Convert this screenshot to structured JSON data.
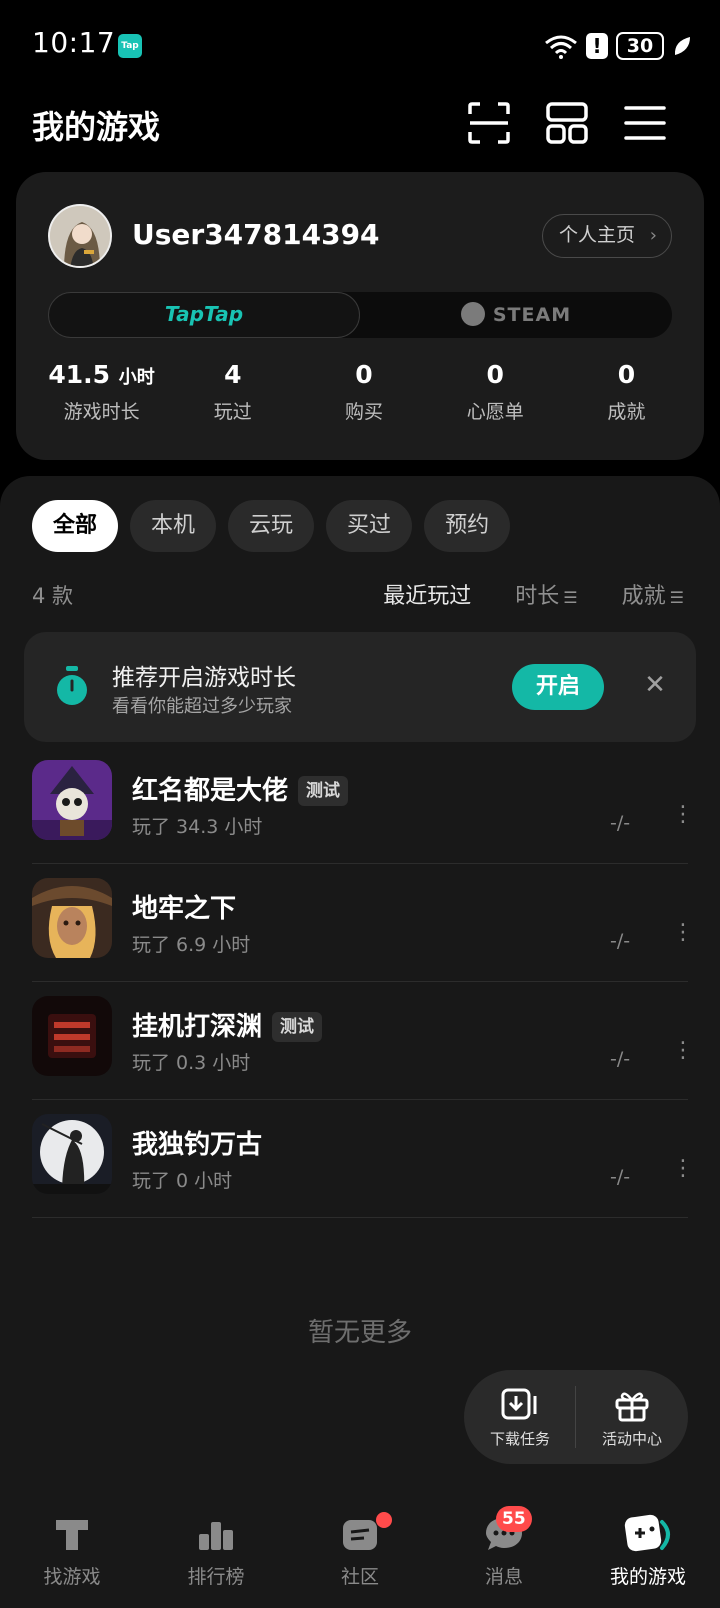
{
  "status_bar": {
    "time": "10:17",
    "app_badge": "Tap",
    "battery": "30"
  },
  "header": {
    "title": "我的游戏"
  },
  "profile": {
    "username": "User347814394",
    "homepage_label": "个人主页",
    "platforms": {
      "taptap": "TapTap",
      "steam": "STEAM"
    },
    "stats": [
      {
        "value": "41.5",
        "unit": "小时",
        "label": "游戏时长"
      },
      {
        "value": "4",
        "unit": "",
        "label": "玩过"
      },
      {
        "value": "0",
        "unit": "",
        "label": "购买"
      },
      {
        "value": "0",
        "unit": "",
        "label": "心愿单"
      },
      {
        "value": "0",
        "unit": "",
        "label": "成就"
      }
    ]
  },
  "filters": [
    "全部",
    "本机",
    "云玩",
    "买过",
    "预约"
  ],
  "list_header": {
    "count": "4 款",
    "sort_recent": "最近玩过",
    "sort_time": "时长",
    "sort_achievement": "成就"
  },
  "recommend": {
    "title": "推荐开启游戏时长",
    "subtitle": "看看你能超过多少玩家",
    "button": "开启"
  },
  "games": [
    {
      "name": "红名都是大佬",
      "tag": "测试",
      "played": "玩了 34.3 小时",
      "score": "-/-"
    },
    {
      "name": "地牢之下",
      "tag": "",
      "played": "玩了 6.9 小时",
      "score": "-/-"
    },
    {
      "name": "挂机打深渊",
      "tag": "测试",
      "played": "玩了 0.3 小时",
      "score": "-/-"
    },
    {
      "name": "我独钓万古",
      "tag": "",
      "played": "玩了 0 小时",
      "score": "-/-"
    }
  ],
  "no_more": "暂无更多",
  "float_actions": {
    "download": "下载任务",
    "activity": "活动中心"
  },
  "bottom_nav": [
    {
      "label": "找游戏"
    },
    {
      "label": "排行榜"
    },
    {
      "label": "社区"
    },
    {
      "label": "消息",
      "badge": "55"
    },
    {
      "label": "我的游戏"
    }
  ],
  "colors": {
    "accent": "#14b8a6",
    "badge": "#ff4b4b",
    "background": "#000000",
    "card": "#1c1c1c"
  }
}
